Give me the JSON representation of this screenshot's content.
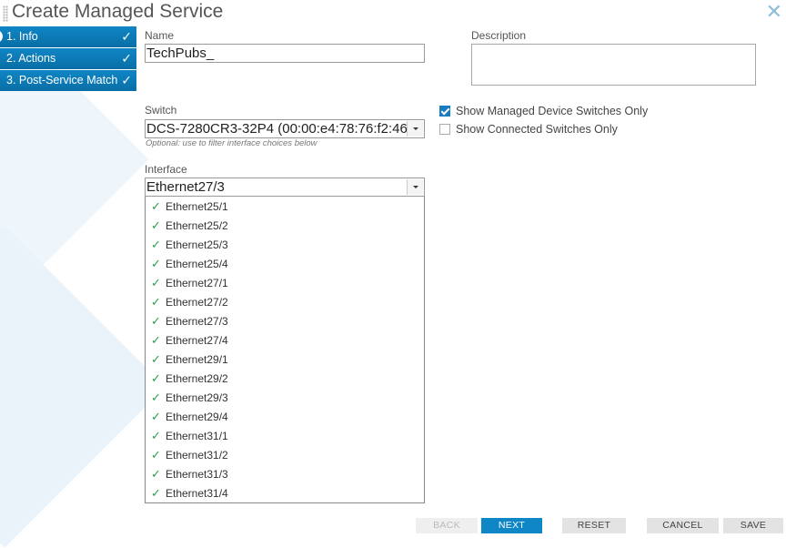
{
  "dialog": {
    "title": "Create Managed Service",
    "close_icon": "close-icon"
  },
  "steps": [
    {
      "label": "1. Info"
    },
    {
      "label": "2. Actions"
    },
    {
      "label": "3. Post-Service Match"
    }
  ],
  "form": {
    "name_label": "Name",
    "name_value": "TechPubs_",
    "description_label": "Description",
    "description_value": "",
    "switch_label": "Switch",
    "switch_value": "DCS-7280CR3-32P4 (00:00:e4:78:76:f2:46",
    "switch_hint": "Optional: use to filter interface choices below",
    "interface_label": "Interface",
    "interface_value": "Ethernet27/3"
  },
  "filters": {
    "managed_only_label": "Show Managed Device Switches Only",
    "managed_only_checked": true,
    "connected_only_label": "Show Connected Switches Only",
    "connected_only_checked": false
  },
  "interface_options": [
    "Ethernet25/1",
    "Ethernet25/2",
    "Ethernet25/3",
    "Ethernet25/4",
    "Ethernet27/1",
    "Ethernet27/2",
    "Ethernet27/3",
    "Ethernet27/4",
    "Ethernet29/1",
    "Ethernet29/2",
    "Ethernet29/3",
    "Ethernet29/4",
    "Ethernet31/1",
    "Ethernet31/2",
    "Ethernet31/3",
    "Ethernet31/4"
  ],
  "buttons": {
    "back": "BACK",
    "next": "NEXT",
    "reset": "RESET",
    "cancel": "CANCEL",
    "save": "SAVE"
  },
  "colors": {
    "accent": "#0f86c5",
    "check": "#2aa14a"
  }
}
